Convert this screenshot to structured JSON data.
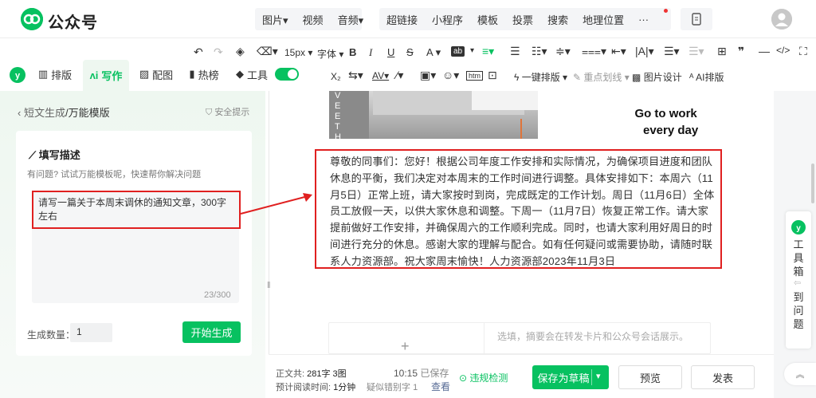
{
  "app": {
    "title": "公众号"
  },
  "topnav": {
    "items": [
      "图片",
      "视频",
      "音频"
    ],
    "items2": [
      "超链接",
      "小程序",
      "模板",
      "投票",
      "搜索",
      "地理位置",
      "···"
    ]
  },
  "toolbar": {
    "font_size": "15px",
    "font_family": "字体",
    "tabs": [
      "排版",
      "写作",
      "配图",
      "热榜",
      "工具"
    ],
    "quick_format": "一键排版",
    "highlight": "重点划线",
    "image_design": "图片设计",
    "ai_layout": "AI排版",
    "format_label": "A",
    "bg_label": "ab"
  },
  "left": {
    "breadcrumb_back": "短文生成",
    "breadcrumb_current": "/万能模版",
    "safety": "安全提示",
    "card_title": "填写描述",
    "card_hint": "有问题? 试试万能模板呢，快速帮你解决问题",
    "prompt": "请写一篇关于本周末调休的通知文章，300字左右",
    "counter": "23/300",
    "qty_label": "生成数量：",
    "qty_value": "1",
    "generate": "开始生成"
  },
  "editor": {
    "image_caption_1": "Go to work",
    "image_caption_2": "every day",
    "image_vert": "VE ETHER",
    "body": "尊敬的同事们：您好！根据公司年度工作安排和实际情况，为确保项目进度和团队休息的平衡，我们决定对本周末的工作时间进行调整。具体安排如下：本周六（11月5日）正常上班，请大家按时到岗，完成既定的工作计划。周日（11月6日）全体员工放假一天，以供大家休息和调整。下周一（11月7日）恢复正常工作。请大家提前做好工作安排，并确保周六的工作顺利完成。同时，也请大家利用好周日的时间进行充分的休息。感谢大家的理解与配合。如有任何疑问或需要协助，请随时联系人力资源部。祝大家周末愉快！人力资源部2023年11月3日",
    "summary_placeholder": "选填，摘要会在转发卡片和公众号会话展示。"
  },
  "status": {
    "words_label": "正文共:",
    "words": "281字 3图",
    "read_label": "预计阅读时间:",
    "read": "1分钟",
    "time": "10:15",
    "saved": "已保存",
    "typo_label": "疑似错别字",
    "typo": "1",
    "check": "查看",
    "violation": "违规检测"
  },
  "actions": {
    "save_draft": "保存为草稿",
    "preview": "预览",
    "publish": "发表"
  },
  "right": {
    "toolbox": [
      "工",
      "具",
      "箱"
    ],
    "back": [
      "到",
      "问",
      "题"
    ]
  },
  "colors": {
    "brand": "#07c160",
    "annotation": "#e02020"
  }
}
